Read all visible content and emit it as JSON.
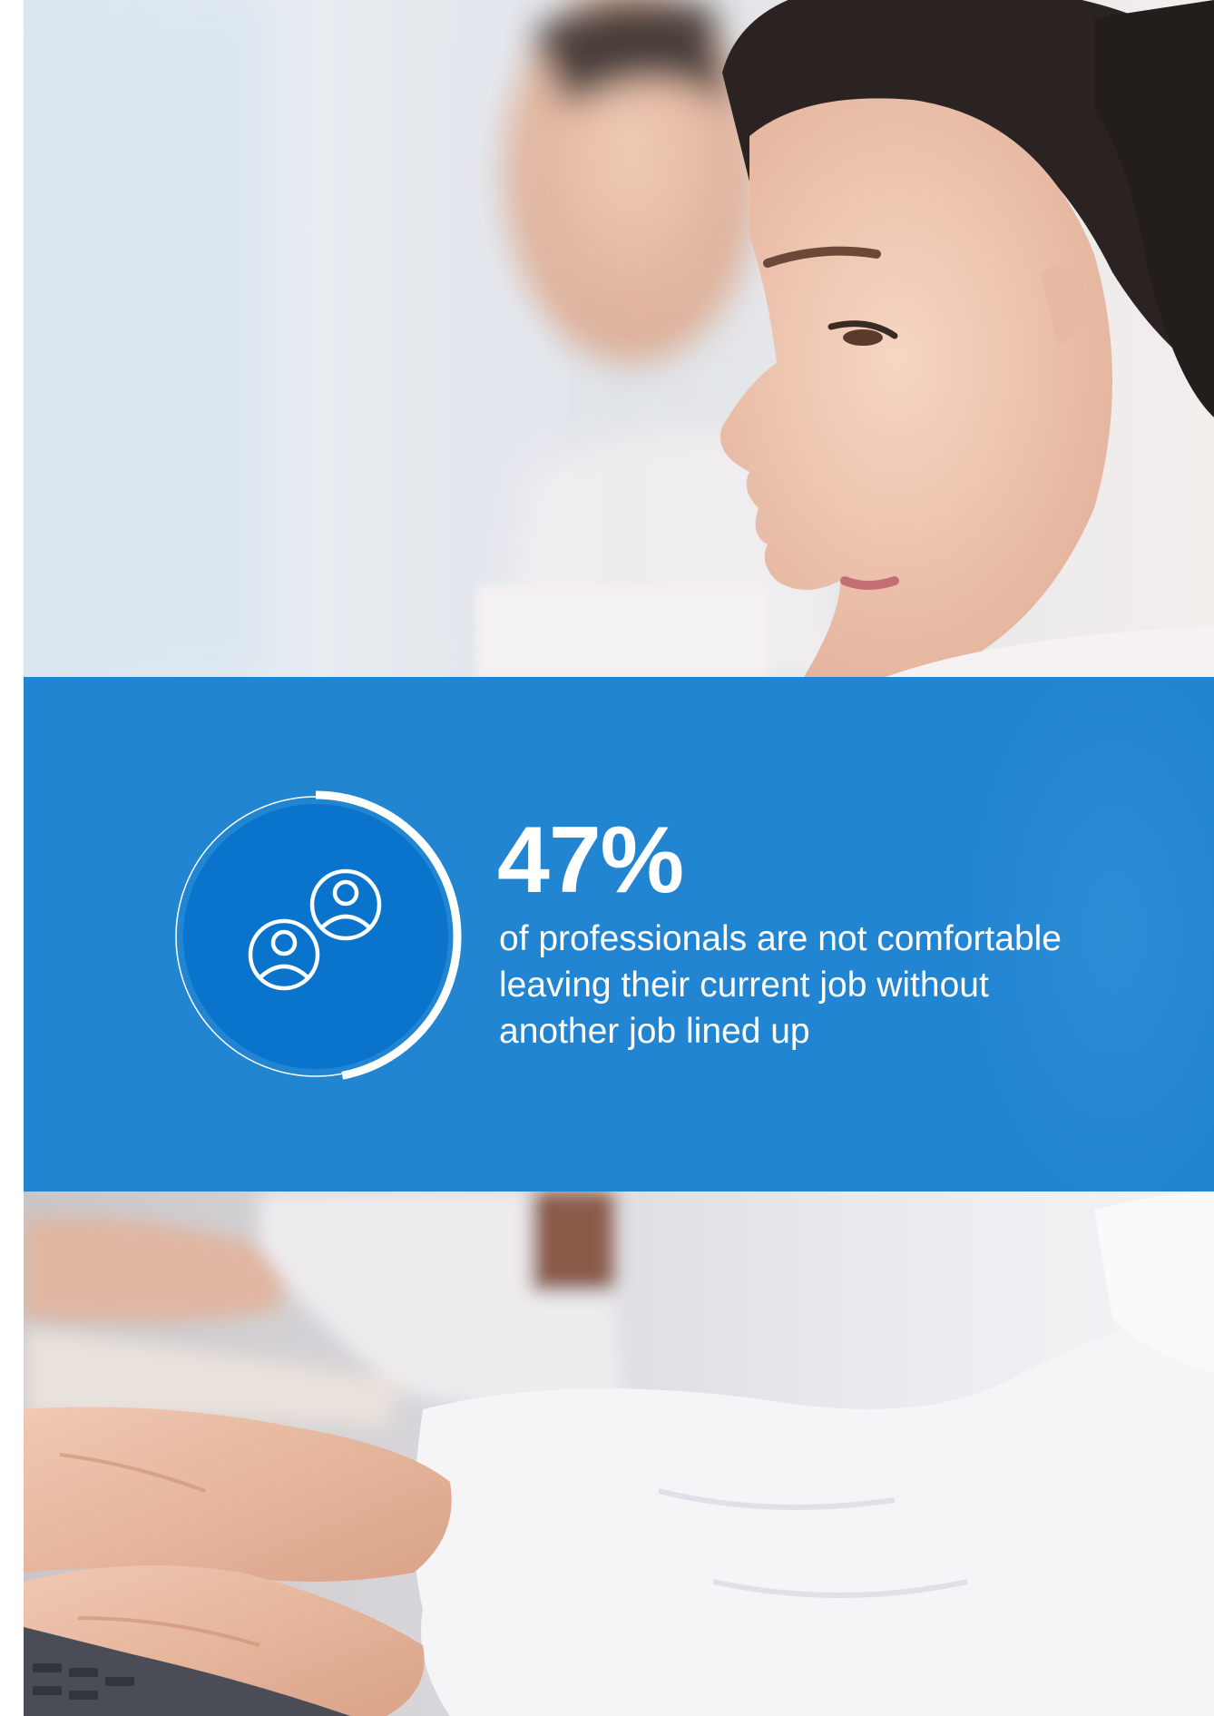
{
  "stat": {
    "value": "47%",
    "description": "of professionals are not comfortable leaving their current job without another job lined up",
    "progress_fraction": 0.47
  },
  "icon": "two-people-users-icon",
  "colors": {
    "band": "#2185d2",
    "circle": "#0a73cc",
    "text": "#ffffff"
  }
}
